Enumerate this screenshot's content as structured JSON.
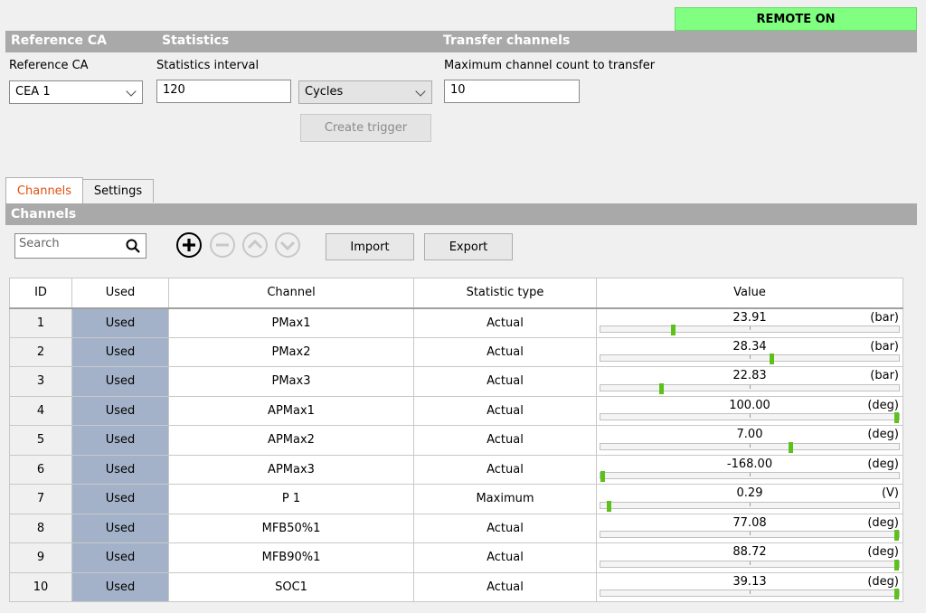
{
  "status": {
    "remote": "REMOTE ON"
  },
  "sections": {
    "reference_ca": "Reference CA",
    "statistics": "Statistics",
    "transfer_channels": "Transfer channels"
  },
  "form": {
    "reference_ca_label": "Reference CA",
    "reference_ca_value": "CEA 1",
    "statistics_interval_label": "Statistics interval",
    "statistics_interval_value": "120",
    "interval_unit_value": "Cycles",
    "create_trigger_label": "Create trigger",
    "max_channel_label": "Maximum channel count to transfer",
    "max_channel_value": "10"
  },
  "tabs": [
    {
      "label": "Channels",
      "active": true
    },
    {
      "label": "Settings",
      "active": false
    }
  ],
  "channels_panel": {
    "title": "Channels",
    "search_placeholder": "Search",
    "import_label": "Import",
    "export_label": "Export"
  },
  "table": {
    "columns": [
      "ID",
      "Used",
      "Channel",
      "Statistic type",
      "Value"
    ],
    "rows": [
      {
        "id": "1",
        "used": "Used",
        "channel": "PMax1",
        "stat": "Actual",
        "value": "23.91",
        "unit": "(bar)",
        "level": 0.24
      },
      {
        "id": "2",
        "used": "Used",
        "channel": "PMax2",
        "stat": "Actual",
        "value": "28.34",
        "unit": "(bar)",
        "level": 0.575
      },
      {
        "id": "3",
        "used": "Used",
        "channel": "PMax3",
        "stat": "Actual",
        "value": "22.83",
        "unit": "(bar)",
        "level": 0.2
      },
      {
        "id": "4",
        "used": "Used",
        "channel": "APMax1",
        "stat": "Actual",
        "value": "100.00",
        "unit": "(deg)",
        "level": 1.0
      },
      {
        "id": "5",
        "used": "Used",
        "channel": "APMax2",
        "stat": "Actual",
        "value": "7.00",
        "unit": "(deg)",
        "level": 0.64
      },
      {
        "id": "6",
        "used": "Used",
        "channel": "APMax3",
        "stat": "Actual",
        "value": "-168.00",
        "unit": "(deg)",
        "level": 0.0
      },
      {
        "id": "7",
        "used": "Used",
        "channel": "P 1",
        "stat": "Maximum",
        "value": "0.29",
        "unit": "(V)",
        "level": 0.02
      },
      {
        "id": "8",
        "used": "Used",
        "channel": "MFB50%1",
        "stat": "Actual",
        "value": "77.08",
        "unit": "(deg)",
        "level": 1.0
      },
      {
        "id": "9",
        "used": "Used",
        "channel": "MFB90%1",
        "stat": "Actual",
        "value": "88.72",
        "unit": "(deg)",
        "level": 1.0
      },
      {
        "id": "10",
        "used": "Used",
        "channel": "SOC1",
        "stat": "Actual",
        "value": "39.13",
        "unit": "(deg)",
        "level": 1.0
      }
    ]
  },
  "colors": {
    "remote_bg": "#80ff80",
    "section_bar": "#a9a9a9",
    "used_cell": "#a3b2c9",
    "active_tab_text": "#e05010",
    "level_marker": "#5cc21a"
  },
  "icons": [
    "search-icon",
    "add-icon",
    "remove-icon",
    "move-up-icon",
    "move-down-icon",
    "chevron-down-icon"
  ]
}
